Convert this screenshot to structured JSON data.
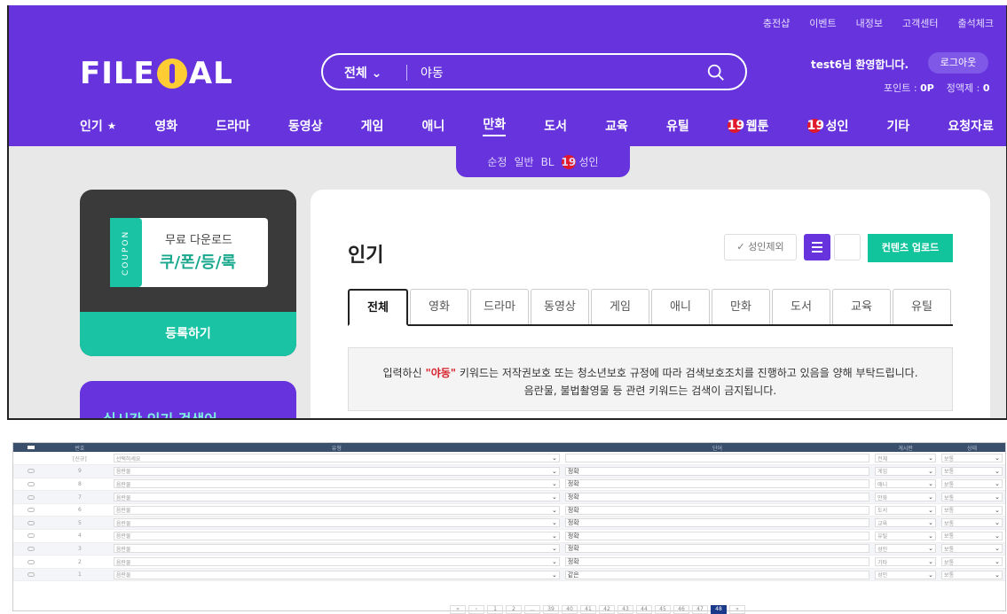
{
  "top_links": [
    "충전샵",
    "이벤트",
    "내정보",
    "고객센터",
    "출석체크"
  ],
  "logo": {
    "left": "FILE",
    "right": "AL"
  },
  "search": {
    "category": "전체",
    "query": "야동"
  },
  "user": {
    "greeting": "test6님 환영합니다.",
    "logout": "로그아웃",
    "points_label": "포인트 :",
    "points": "0P",
    "flat_label": "정액제 :",
    "flat": "0"
  },
  "nav": [
    "인기",
    "영화",
    "드라마",
    "동영상",
    "게임",
    "애니",
    "만화",
    "도서",
    "교육",
    "유틸",
    "웹툰",
    "성인",
    "기타",
    "요청자료"
  ],
  "adult_badge": "19",
  "sub_nav": [
    "순정",
    "일반",
    "BL",
    "성인"
  ],
  "coupon": {
    "side": "COUPON",
    "line1": "무료 다운로드",
    "line2": "쿠/폰/등/록",
    "button": "등록하기"
  },
  "realtime": "실시간 인기 검색어",
  "main": {
    "title": "인기",
    "exclude_adult": "성인제외",
    "upload": "컨텐츠 업로드"
  },
  "tabs": [
    "전체",
    "영화",
    "드라마",
    "동영상",
    "게임",
    "애니",
    "만화",
    "도서",
    "교육",
    "유틸"
  ],
  "notice": {
    "pre": "입력하신 ",
    "keyword": "\"야동\"",
    "post": " 키워드는 저작권보호 또는 청소년보호 규정에 따라 검색보호조치를 진행하고 있음을 양해 부탁드립니다.",
    "line2": "음란물, 불법촬영물 등 관련 키워드는 검색이 금지됩니다."
  },
  "table": {
    "headers": [
      "",
      "번호",
      "유형",
      "단어",
      "게시판",
      "상태"
    ],
    "first_row": {
      "no": "[신규]",
      "type": "선택하세요",
      "word": "",
      "board": "전체",
      "status": "보통"
    },
    "rows": [
      {
        "no": "9",
        "type": "음란물",
        "word": "정확",
        "board": "게임",
        "status": "보통"
      },
      {
        "no": "8",
        "type": "음란물",
        "word": "정확",
        "board": "애니",
        "status": "보통"
      },
      {
        "no": "7",
        "type": "음란물",
        "word": "정확",
        "board": "만화",
        "status": "보통"
      },
      {
        "no": "6",
        "type": "음란물",
        "word": "정확",
        "board": "도서",
        "status": "보통"
      },
      {
        "no": "5",
        "type": "음란물",
        "word": "정확",
        "board": "교육",
        "status": "보통"
      },
      {
        "no": "4",
        "type": "음란물",
        "word": "정확",
        "board": "유틸",
        "status": "보통"
      },
      {
        "no": "3",
        "type": "음란물",
        "word": "정확",
        "board": "성인",
        "status": "보통"
      },
      {
        "no": "2",
        "type": "음란물",
        "word": "정확",
        "board": "기타",
        "status": "보통"
      },
      {
        "no": "1",
        "type": "음란물",
        "word": "같은",
        "board": "성인",
        "status": "보통"
      }
    ]
  },
  "pager": [
    "«",
    "‹",
    "1",
    "2",
    "...",
    "39",
    "40",
    "41",
    "42",
    "43",
    "44",
    "45",
    "46",
    "47",
    "48",
    "»"
  ],
  "pager_current": "48",
  "colors": {
    "brand": "#6633dd",
    "accent": "#11c49c",
    "adult": "#e0192d"
  }
}
